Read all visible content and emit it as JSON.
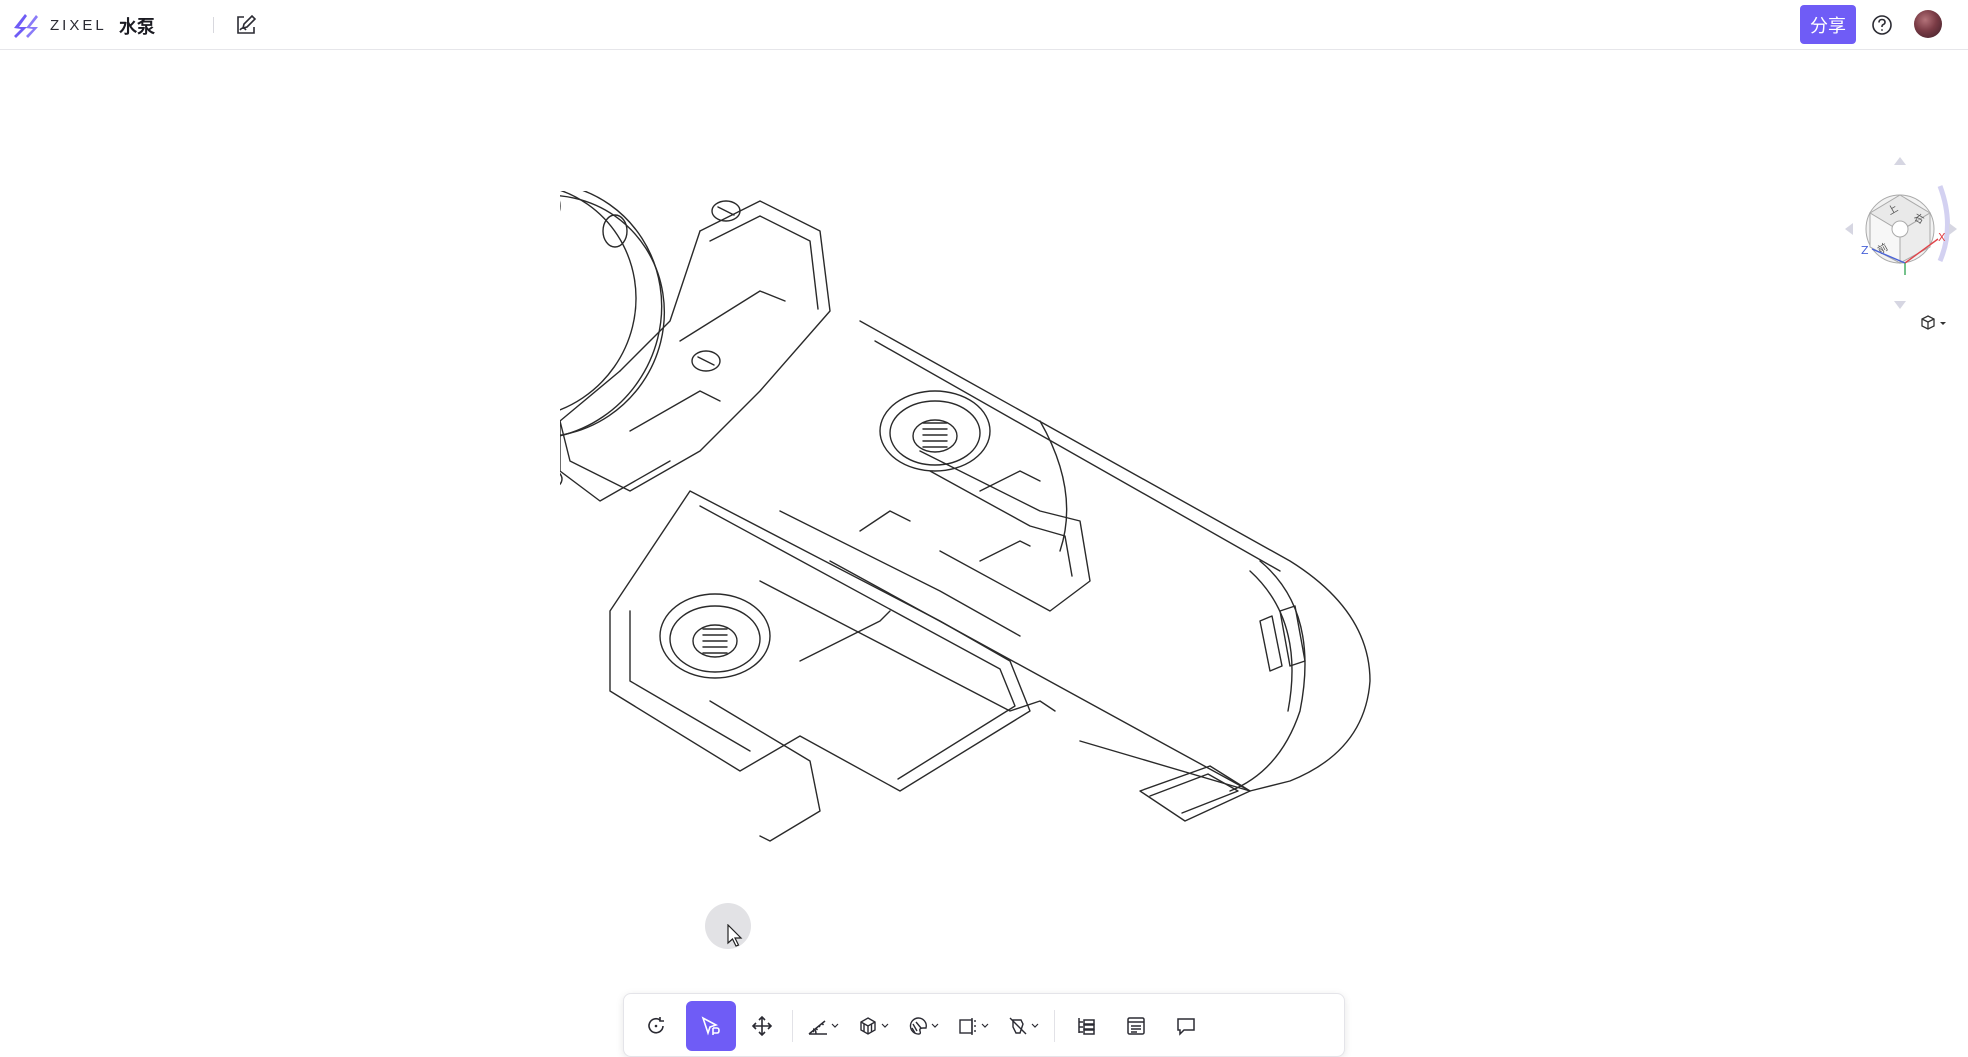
{
  "app": {
    "brand": "ZIXEL",
    "document_title": "水泵",
    "share_label": "分享",
    "brand_color": "#6f5cf6"
  },
  "header": {
    "icons": [
      "zixel-logo-icon",
      "edit-icon",
      "help-icon",
      "user-avatar"
    ]
  },
  "nav_cube": {
    "faces": [
      "上",
      "前",
      "右"
    ],
    "axes": [
      "Z",
      "X"
    ],
    "axis_colors": {
      "x": "#e0444a",
      "y": "#3aa75a",
      "z": "#4a63d8"
    }
  },
  "toolbar": {
    "buttons": [
      {
        "name": "reset-view-button",
        "icon": "rotate-reset-icon",
        "dropdown": false,
        "active": false
      },
      {
        "name": "select-button",
        "icon": "select-cursor-icon",
        "dropdown": false,
        "active": true
      },
      {
        "name": "move-button",
        "icon": "move-arrows-icon",
        "dropdown": false,
        "active": false
      },
      {
        "name": "measure-button",
        "icon": "ruler-icon",
        "dropdown": true,
        "active": false
      },
      {
        "name": "explode-button",
        "icon": "explode-cube-icon",
        "dropdown": true,
        "active": false
      },
      {
        "name": "material-button",
        "icon": "material-palette-icon",
        "dropdown": true,
        "active": false
      },
      {
        "name": "section-button",
        "icon": "section-plane-icon",
        "dropdown": true,
        "active": false
      },
      {
        "name": "hide-button",
        "icon": "hide-part-icon",
        "dropdown": true,
        "active": false
      },
      {
        "name": "model-tree-button",
        "icon": "tree-list-icon",
        "dropdown": false,
        "active": false
      },
      {
        "name": "properties-button",
        "icon": "properties-list-icon",
        "dropdown": false,
        "active": false
      },
      {
        "name": "comment-button",
        "icon": "comment-bubble-icon",
        "dropdown": false,
        "active": false
      }
    ]
  },
  "viewport": {
    "model_icon": "water-pump-3d-model"
  }
}
